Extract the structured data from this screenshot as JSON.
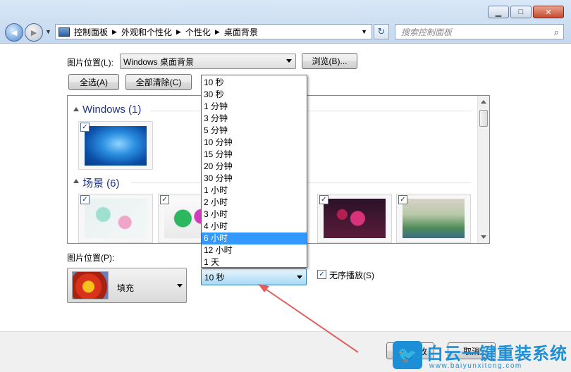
{
  "window": {
    "minimize": "▁",
    "maximize": "□",
    "close": "✕"
  },
  "nav": {
    "back": "◄",
    "forward": "►",
    "history_drop": "▼"
  },
  "address": {
    "crumbs": [
      "控制面板",
      "外观和个性化",
      "个性化",
      "桌面背景"
    ],
    "separator": "▶",
    "drop": "▼",
    "refresh": "↻"
  },
  "search": {
    "placeholder": "搜索控制面板",
    "icon": "search-icon"
  },
  "picture_location": {
    "label": "图片位置(L):",
    "value": "Windows 桌面背景",
    "browse": "浏览(B)..."
  },
  "select_all": "全选(A)",
  "clear_all": "全部清除(C)",
  "gallery": {
    "groups": [
      {
        "title": "Windows (1)"
      },
      {
        "title": "场景 (6)"
      }
    ],
    "check": "✓"
  },
  "picture_position": {
    "label": "图片位置(P):",
    "value": "填充"
  },
  "interval": {
    "value": "10 秒",
    "options": [
      "10 秒",
      "30 秒",
      "1 分钟",
      "3 分钟",
      "5 分钟",
      "10 分钟",
      "15 分钟",
      "20 分钟",
      "30 分钟",
      "1 小时",
      "2 小时",
      "3 小时",
      "4 小时",
      "6 小时",
      "12 小时",
      "1 天"
    ],
    "highlighted": "6 小时"
  },
  "shuffle": {
    "label": "无序播放(S)",
    "checked": "✓"
  },
  "footer": {
    "save": "保存修改",
    "cancel": "取消"
  },
  "watermark": {
    "brand": "白云一键重装系统",
    "url": "www.baiyunxitong.com",
    "logo_glyph": "🐦"
  },
  "colors": {
    "accent_blue": "#1e3287",
    "selection": "#3399ff",
    "annotation_arrow": "#e06060",
    "watermark": "#1c8fd6"
  }
}
